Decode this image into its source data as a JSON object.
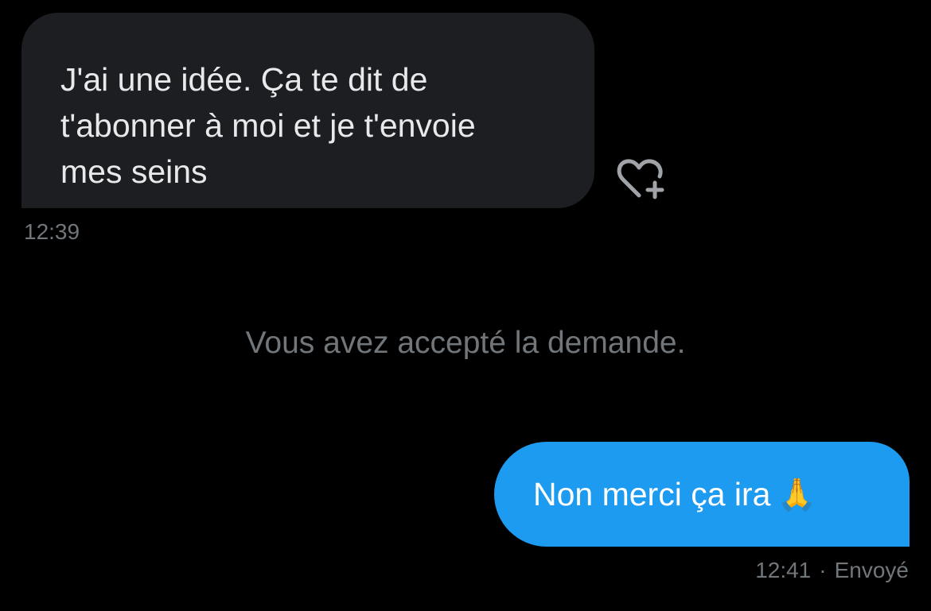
{
  "conversation": {
    "received_message": {
      "text": "J'ai une idée. Ça te dit de\nt'abonner à moi et je t'envoie\nmes seins",
      "timestamp": "12:39",
      "reaction_icon": "heart-plus-icon"
    },
    "system_message": "Vous avez accepté la demande.",
    "sent_message": {
      "text": "Non merci ça ira",
      "emoji": "🙏",
      "timestamp": "12:41",
      "separator": "·",
      "status": "Envoyé"
    }
  },
  "colors": {
    "background": "#000000",
    "received_bubble": "#1d1e21",
    "sent_bubble": "#1d9bf0",
    "muted_text": "#71767b"
  }
}
